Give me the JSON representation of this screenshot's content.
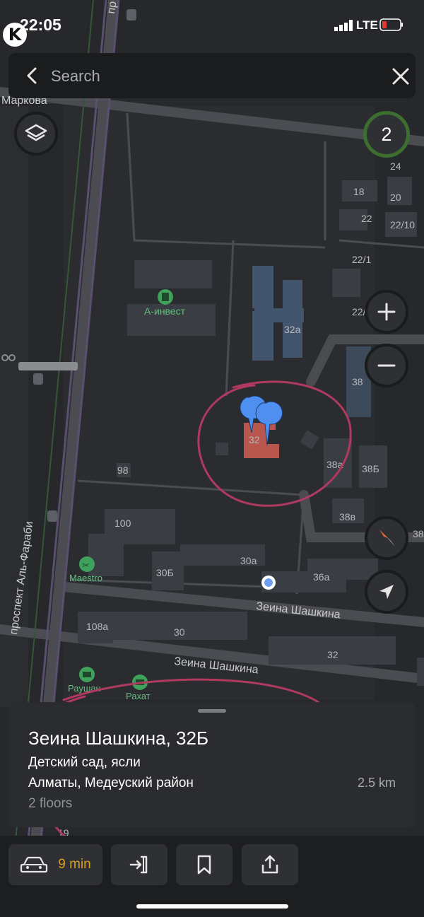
{
  "status_bar": {
    "time": "22:05",
    "network": "LTE",
    "app_badge": "K"
  },
  "search": {
    "placeholder": "Search"
  },
  "map": {
    "street_labels": [
      "Маркова",
      "проспект Аль-Фараби",
      "Зеина Шашкина",
      "Зеина Шашкина",
      "пр"
    ],
    "building_labels": [
      "18",
      "20",
      "22",
      "22/10",
      "22/1",
      "22/2",
      "24",
      "32а",
      "32",
      "38",
      "38а",
      "38Б",
      "38в",
      "38",
      "98",
      "100",
      "30Б",
      "30а",
      "36а",
      "108а",
      "30",
      "32",
      "19"
    ],
    "poi": [
      {
        "name": "А-инвест",
        "icon": "building-icon"
      },
      {
        "name": "Maestro",
        "icon": "scissors-icon"
      },
      {
        "name": "Раушан",
        "icon": "basket-icon"
      },
      {
        "name": "Рахат",
        "icon": "basket-icon"
      }
    ],
    "cluster_count": "2"
  },
  "place": {
    "title": "Зеина Шашкина, 32Б",
    "type": "Детский сад, ясли",
    "address": "Алматы, Медеуский район",
    "floors": "2 floors",
    "distance": "2.5 km"
  },
  "actions": {
    "route_time": "9 min"
  },
  "colors": {
    "route_time": "#d5a023",
    "pin": "#4f8ff0",
    "selected_building": "#b9574f",
    "annotation": "#b0395f",
    "cluster_ring": "#3c6e2f"
  }
}
